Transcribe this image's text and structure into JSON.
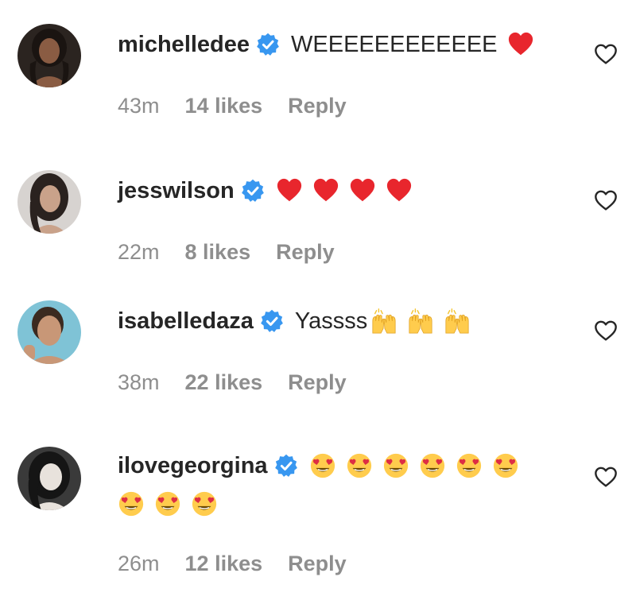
{
  "comments": [
    {
      "username": "michelledee",
      "text": "WEEEEEEEEEEEE",
      "emojis": [
        "red-heart"
      ],
      "emojis_row2": [],
      "time": "43m",
      "likes": "14 likes",
      "reply": "Reply",
      "avatar_colors": {
        "bg": "#2b2420",
        "skin": "#8a5c43",
        "hair": "#1a1411"
      }
    },
    {
      "username": "jesswilson",
      "text": "",
      "emojis": [
        "red-heart",
        "red-heart",
        "red-heart",
        "red-heart"
      ],
      "emojis_row2": [],
      "time": "22m",
      "likes": "8 likes",
      "reply": "Reply",
      "avatar_colors": {
        "bg": "#d7d3d0",
        "skin": "#c9a28a",
        "hair": "#2a221f"
      }
    },
    {
      "username": "isabelledaza",
      "text": "Yassss",
      "emojis": [
        "raising-hands",
        "raising-hands",
        "raising-hands"
      ],
      "emojis_row2": [],
      "time": "38m",
      "likes": "22 likes",
      "reply": "Reply",
      "avatar_colors": {
        "bg": "#7fc3d6",
        "skin": "#c89777",
        "hair": "#3b2a20"
      }
    },
    {
      "username": "ilovegeorgina",
      "text": "",
      "emojis": [
        "heart-eyes",
        "heart-eyes",
        "heart-eyes",
        "heart-eyes",
        "heart-eyes",
        "heart-eyes"
      ],
      "emojis_row2": [
        "heart-eyes",
        "heart-eyes",
        "heart-eyes"
      ],
      "time": "26m",
      "likes": "12 likes",
      "reply": "Reply",
      "avatar_colors": {
        "bg": "#3a3a3a",
        "skin": "#e8e2dc",
        "hair": "#151515"
      }
    }
  ],
  "colors": {
    "verified": "#3897f0",
    "heart": "#ed4956",
    "meta_text": "#8e8e8e",
    "username": "#262626"
  }
}
